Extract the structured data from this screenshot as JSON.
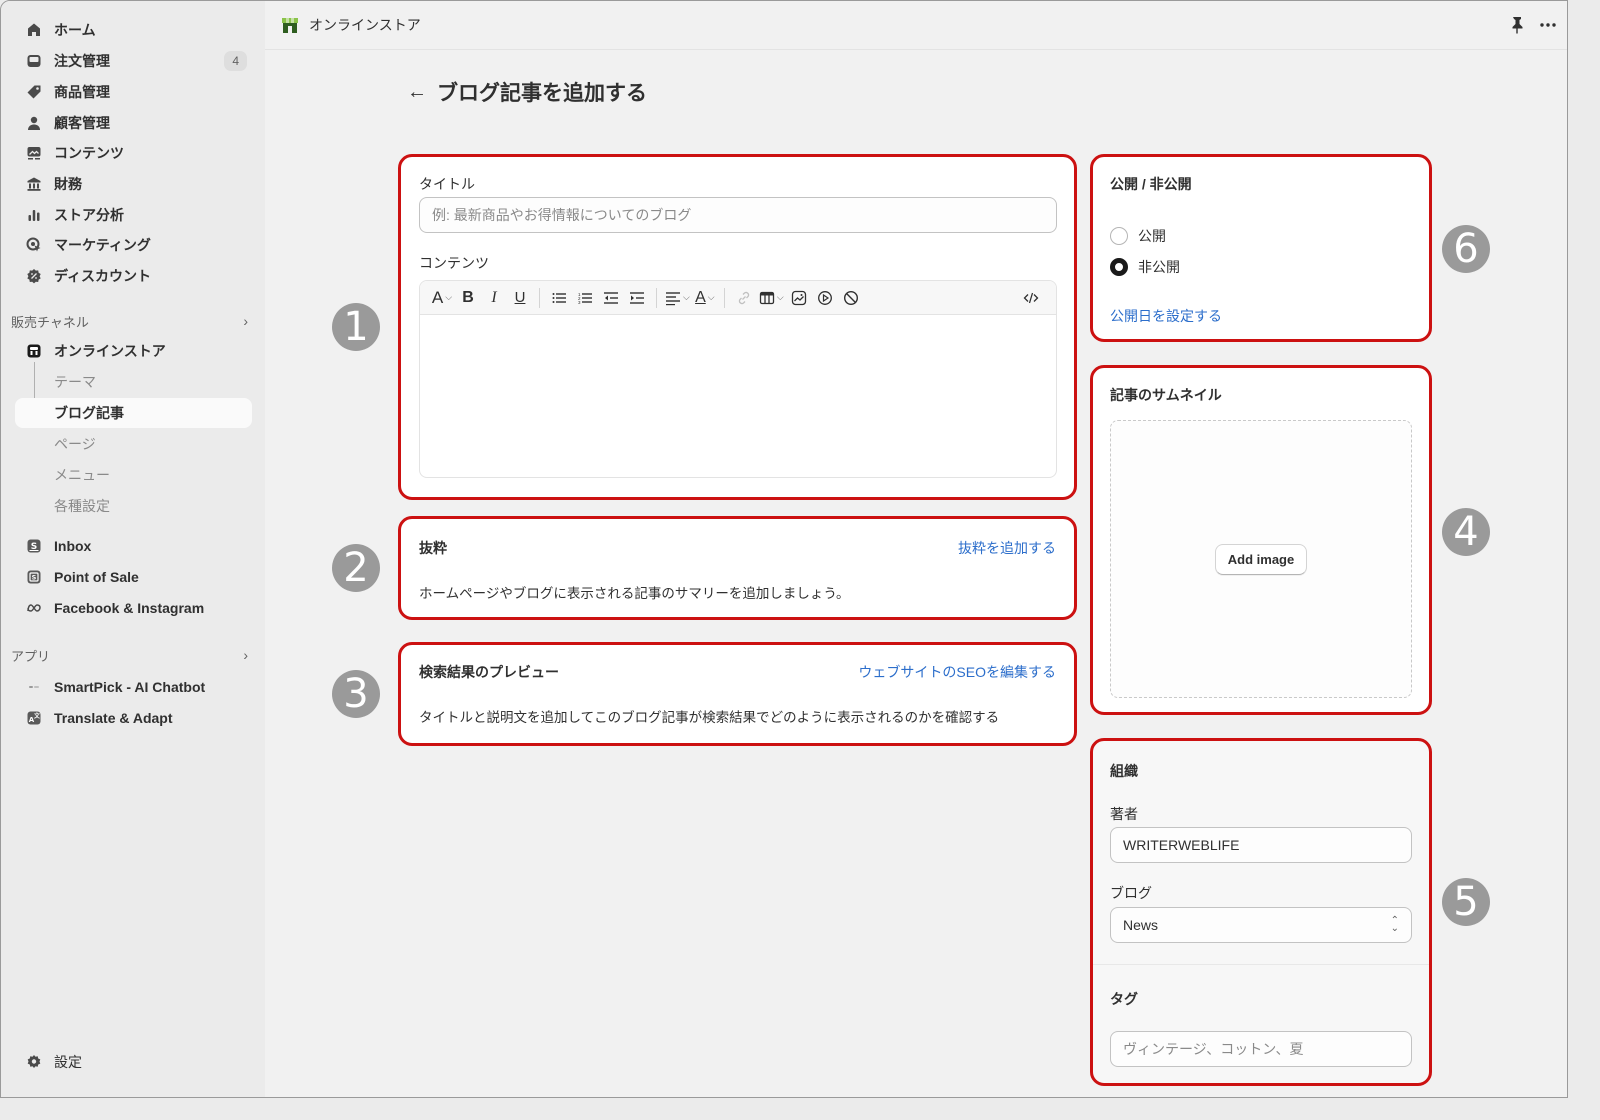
{
  "sidebar": {
    "items": [
      {
        "label": "ホーム",
        "icon": "home-icon"
      },
      {
        "label": "注文管理",
        "icon": "inbox-icon",
        "badge": "4"
      },
      {
        "label": "商品管理",
        "icon": "tag-icon"
      },
      {
        "label": "顧客管理",
        "icon": "person-icon"
      },
      {
        "label": "コンテンツ",
        "icon": "image-icon"
      },
      {
        "label": "財務",
        "icon": "bank-icon"
      },
      {
        "label": "ストア分析",
        "icon": "bar-chart-icon"
      },
      {
        "label": "マーケティング",
        "icon": "target-icon"
      },
      {
        "label": "ディスカウント",
        "icon": "discount-icon"
      }
    ],
    "sales_channels": {
      "heading": "販売チャネル",
      "online_store": "オンラインストア",
      "sub_items": [
        "テーマ",
        "ブログ記事",
        "ページ",
        "メニュー",
        "各種設定"
      ],
      "active_sub": "ブログ記事",
      "others": [
        {
          "label": "Inbox",
          "icon": "shopify-inbox-icon"
        },
        {
          "label": "Point of Sale",
          "icon": "pos-icon"
        },
        {
          "label": "Facebook & Instagram",
          "icon": "meta-icon"
        }
      ]
    },
    "apps": {
      "heading": "アプリ",
      "items": [
        {
          "label": "SmartPick - AI Chatbot",
          "icon": "smartpick-icon"
        },
        {
          "label": "Translate & Adapt",
          "icon": "translate-icon"
        }
      ]
    },
    "settings": "設定"
  },
  "topbar": {
    "store_name": "オンラインストア"
  },
  "page": {
    "title": "ブログ記事を追加する"
  },
  "content_card": {
    "title_label": "タイトル",
    "title_placeholder": "例: 最新商品やお得情報についてのブログ",
    "content_label": "コンテンツ"
  },
  "excerpt_card": {
    "title": "抜粋",
    "action": "抜粋を追加する",
    "description": "ホームページやブログに表示される記事のサマリーを追加しましょう。"
  },
  "seo_card": {
    "title": "検索結果のプレビュー",
    "action": "ウェブサイトのSEOを編集する",
    "description": "タイトルと説明文を追加してこのブログ記事が検索結果でどのように表示されるのかを確認する"
  },
  "visibility_card": {
    "title": "公開 / 非公開",
    "options": [
      "公開",
      "非公開"
    ],
    "selected": "非公開",
    "action": "公開日を設定する"
  },
  "thumbnail_card": {
    "title": "記事のサムネイル",
    "button": "Add image"
  },
  "organization_card": {
    "title": "組織",
    "author_label": "著者",
    "author_value": "WRITERWEBLIFE",
    "blog_label": "ブログ",
    "blog_value": "News",
    "tags_label": "タグ",
    "tags_placeholder": "ヴィンテージ、コットン、夏"
  },
  "annotations": [
    "❶",
    "❷",
    "❸",
    "❹",
    "❺",
    "❻"
  ],
  "annotation_numbers": [
    "1",
    "2",
    "3",
    "4",
    "5",
    "6"
  ],
  "colors": {
    "highlight": "#cc1111",
    "link": "#2c6ecb",
    "annotation": "#9a9a9a"
  }
}
